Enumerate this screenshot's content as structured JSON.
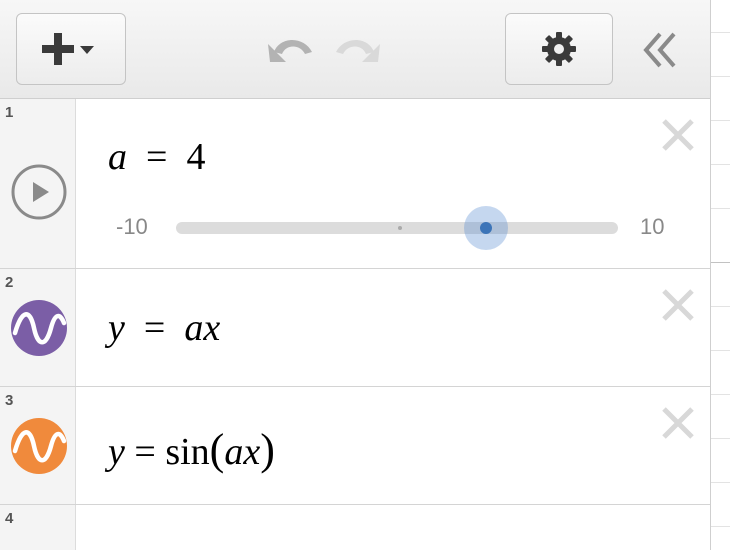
{
  "toolbar": {
    "add_button": "add-expression",
    "undo": "undo",
    "redo": "redo",
    "settings": "settings",
    "collapse": "collapse-list"
  },
  "colors": {
    "curve_purple": "#7b5ea6",
    "curve_orange": "#f08a3c",
    "slider_thumb": "#3c74b8"
  },
  "expressions": [
    {
      "number": "1",
      "lhs": "a",
      "eq": "=",
      "rhs": "4",
      "slider": {
        "min": "-10",
        "max": "10",
        "value": 4
      }
    },
    {
      "number": "2",
      "lhs": "y",
      "eq": "=",
      "rhs": "ax",
      "color": "purple"
    },
    {
      "number": "3",
      "lhs": "y",
      "eq": "=",
      "func": "sin",
      "open": "(",
      "arg": "ax",
      "close": ")",
      "color": "orange"
    },
    {
      "number": "4"
    }
  ]
}
